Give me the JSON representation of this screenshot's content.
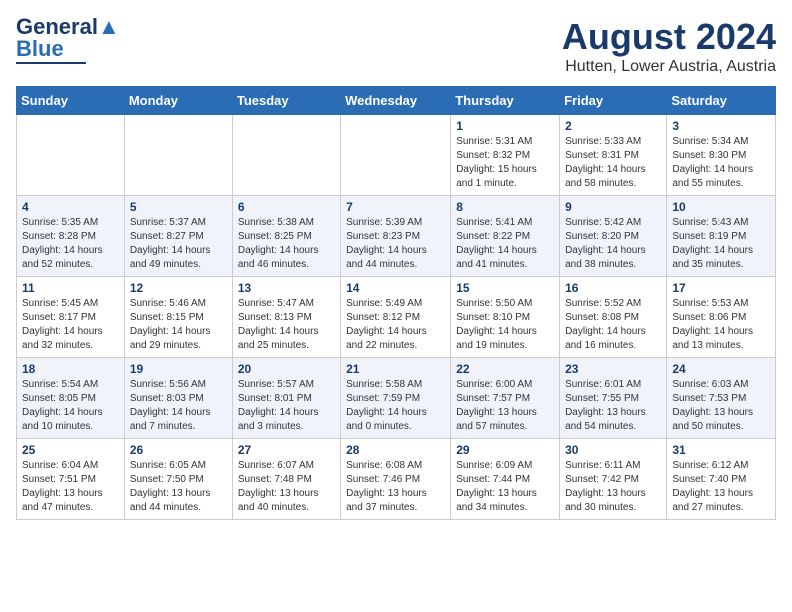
{
  "header": {
    "logo_general": "General",
    "logo_blue": "Blue",
    "month": "August 2024",
    "location": "Hutten, Lower Austria, Austria"
  },
  "weekdays": [
    "Sunday",
    "Monday",
    "Tuesday",
    "Wednesday",
    "Thursday",
    "Friday",
    "Saturday"
  ],
  "weeks": [
    [
      {
        "day": "",
        "sunrise": "",
        "sunset": "",
        "daylight": ""
      },
      {
        "day": "",
        "sunrise": "",
        "sunset": "",
        "daylight": ""
      },
      {
        "day": "",
        "sunrise": "",
        "sunset": "",
        "daylight": ""
      },
      {
        "day": "",
        "sunrise": "",
        "sunset": "",
        "daylight": ""
      },
      {
        "day": "1",
        "sunrise": "Sunrise: 5:31 AM",
        "sunset": "Sunset: 8:32 PM",
        "daylight": "Daylight: 15 hours and 1 minute."
      },
      {
        "day": "2",
        "sunrise": "Sunrise: 5:33 AM",
        "sunset": "Sunset: 8:31 PM",
        "daylight": "Daylight: 14 hours and 58 minutes."
      },
      {
        "day": "3",
        "sunrise": "Sunrise: 5:34 AM",
        "sunset": "Sunset: 8:30 PM",
        "daylight": "Daylight: 14 hours and 55 minutes."
      }
    ],
    [
      {
        "day": "4",
        "sunrise": "Sunrise: 5:35 AM",
        "sunset": "Sunset: 8:28 PM",
        "daylight": "Daylight: 14 hours and 52 minutes."
      },
      {
        "day": "5",
        "sunrise": "Sunrise: 5:37 AM",
        "sunset": "Sunset: 8:27 PM",
        "daylight": "Daylight: 14 hours and 49 minutes."
      },
      {
        "day": "6",
        "sunrise": "Sunrise: 5:38 AM",
        "sunset": "Sunset: 8:25 PM",
        "daylight": "Daylight: 14 hours and 46 minutes."
      },
      {
        "day": "7",
        "sunrise": "Sunrise: 5:39 AM",
        "sunset": "Sunset: 8:23 PM",
        "daylight": "Daylight: 14 hours and 44 minutes."
      },
      {
        "day": "8",
        "sunrise": "Sunrise: 5:41 AM",
        "sunset": "Sunset: 8:22 PM",
        "daylight": "Daylight: 14 hours and 41 minutes."
      },
      {
        "day": "9",
        "sunrise": "Sunrise: 5:42 AM",
        "sunset": "Sunset: 8:20 PM",
        "daylight": "Daylight: 14 hours and 38 minutes."
      },
      {
        "day": "10",
        "sunrise": "Sunrise: 5:43 AM",
        "sunset": "Sunset: 8:19 PM",
        "daylight": "Daylight: 14 hours and 35 minutes."
      }
    ],
    [
      {
        "day": "11",
        "sunrise": "Sunrise: 5:45 AM",
        "sunset": "Sunset: 8:17 PM",
        "daylight": "Daylight: 14 hours and 32 minutes."
      },
      {
        "day": "12",
        "sunrise": "Sunrise: 5:46 AM",
        "sunset": "Sunset: 8:15 PM",
        "daylight": "Daylight: 14 hours and 29 minutes."
      },
      {
        "day": "13",
        "sunrise": "Sunrise: 5:47 AM",
        "sunset": "Sunset: 8:13 PM",
        "daylight": "Daylight: 14 hours and 25 minutes."
      },
      {
        "day": "14",
        "sunrise": "Sunrise: 5:49 AM",
        "sunset": "Sunset: 8:12 PM",
        "daylight": "Daylight: 14 hours and 22 minutes."
      },
      {
        "day": "15",
        "sunrise": "Sunrise: 5:50 AM",
        "sunset": "Sunset: 8:10 PM",
        "daylight": "Daylight: 14 hours and 19 minutes."
      },
      {
        "day": "16",
        "sunrise": "Sunrise: 5:52 AM",
        "sunset": "Sunset: 8:08 PM",
        "daylight": "Daylight: 14 hours and 16 minutes."
      },
      {
        "day": "17",
        "sunrise": "Sunrise: 5:53 AM",
        "sunset": "Sunset: 8:06 PM",
        "daylight": "Daylight: 14 hours and 13 minutes."
      }
    ],
    [
      {
        "day": "18",
        "sunrise": "Sunrise: 5:54 AM",
        "sunset": "Sunset: 8:05 PM",
        "daylight": "Daylight: 14 hours and 10 minutes."
      },
      {
        "day": "19",
        "sunrise": "Sunrise: 5:56 AM",
        "sunset": "Sunset: 8:03 PM",
        "daylight": "Daylight: 14 hours and 7 minutes."
      },
      {
        "day": "20",
        "sunrise": "Sunrise: 5:57 AM",
        "sunset": "Sunset: 8:01 PM",
        "daylight": "Daylight: 14 hours and 3 minutes."
      },
      {
        "day": "21",
        "sunrise": "Sunrise: 5:58 AM",
        "sunset": "Sunset: 7:59 PM",
        "daylight": "Daylight: 14 hours and 0 minutes."
      },
      {
        "day": "22",
        "sunrise": "Sunrise: 6:00 AM",
        "sunset": "Sunset: 7:57 PM",
        "daylight": "Daylight: 13 hours and 57 minutes."
      },
      {
        "day": "23",
        "sunrise": "Sunrise: 6:01 AM",
        "sunset": "Sunset: 7:55 PM",
        "daylight": "Daylight: 13 hours and 54 minutes."
      },
      {
        "day": "24",
        "sunrise": "Sunrise: 6:03 AM",
        "sunset": "Sunset: 7:53 PM",
        "daylight": "Daylight: 13 hours and 50 minutes."
      }
    ],
    [
      {
        "day": "25",
        "sunrise": "Sunrise: 6:04 AM",
        "sunset": "Sunset: 7:51 PM",
        "daylight": "Daylight: 13 hours and 47 minutes."
      },
      {
        "day": "26",
        "sunrise": "Sunrise: 6:05 AM",
        "sunset": "Sunset: 7:50 PM",
        "daylight": "Daylight: 13 hours and 44 minutes."
      },
      {
        "day": "27",
        "sunrise": "Sunrise: 6:07 AM",
        "sunset": "Sunset: 7:48 PM",
        "daylight": "Daylight: 13 hours and 40 minutes."
      },
      {
        "day": "28",
        "sunrise": "Sunrise: 6:08 AM",
        "sunset": "Sunset: 7:46 PM",
        "daylight": "Daylight: 13 hours and 37 minutes."
      },
      {
        "day": "29",
        "sunrise": "Sunrise: 6:09 AM",
        "sunset": "Sunset: 7:44 PM",
        "daylight": "Daylight: 13 hours and 34 minutes."
      },
      {
        "day": "30",
        "sunrise": "Sunrise: 6:11 AM",
        "sunset": "Sunset: 7:42 PM",
        "daylight": "Daylight: 13 hours and 30 minutes."
      },
      {
        "day": "31",
        "sunrise": "Sunrise: 6:12 AM",
        "sunset": "Sunset: 7:40 PM",
        "daylight": "Daylight: 13 hours and 27 minutes."
      }
    ]
  ]
}
